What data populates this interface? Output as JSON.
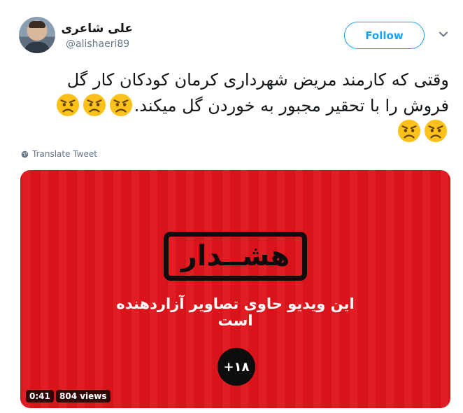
{
  "author": {
    "name": "علی شاعری",
    "handle": "@alishaeri89",
    "avatar_icon": "user-photo"
  },
  "follow_label": "Follow",
  "tweet": {
    "text_line1": "وقتی که کارمند مریض شهرداری کرمان کودکان کار گل",
    "text_line2": "فروش را با تحقیر مجبور به خوردن گل میکند.",
    "emoji_name": "angry-face",
    "emoji_count": 5
  },
  "translate_label": "Translate Tweet",
  "media": {
    "warning_title": "هشــدار",
    "warning_subtitle": "این ویدیو حاوی تصاویر آزاردهنده است",
    "age_label": "+۱۸",
    "duration": "0:41",
    "views": "804 views",
    "background_color": "#e0141b"
  },
  "colors": {
    "accent": "#1da1f2",
    "text": "#14171a",
    "muted": "#657786"
  }
}
